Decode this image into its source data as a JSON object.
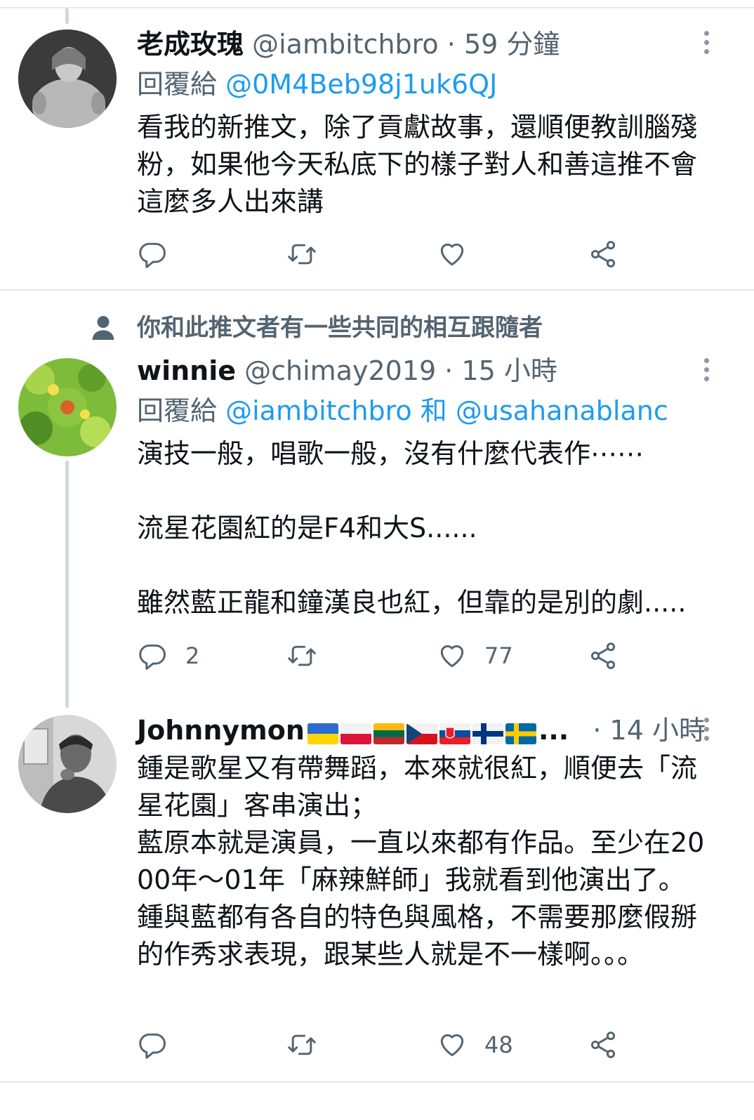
{
  "tweets": [
    {
      "name": "老成玫瑰",
      "handle": "@iambitchbro",
      "dot": "·",
      "time": "59 分鐘",
      "reply_prefix": "回覆給",
      "reply_mentions": [
        "@0M4Beb98j1uk6QJ"
      ],
      "reply_join": "",
      "body": "看我的新推文，除了貢獻故事，還順便教訓腦殘粉，如果他今天私底下的樣子對人和善這推不會這麼多人出來講",
      "reply_count": "",
      "retweet_count": "",
      "like_count": ""
    },
    {
      "social_context": "你和此推文者有一些共同的相互跟隨者",
      "name": "winnie",
      "handle": "@chimay2019",
      "dot": "·",
      "time": "15 小時",
      "reply_prefix": "回覆給",
      "reply_mentions": [
        "@iambitchbro",
        "@usahanablanc"
      ],
      "reply_join": "和",
      "body": "演技一般，唱歌一般，沒有什麼代表作⋯⋯\n\n流星花園紅的是F4和大S......\n\n雖然藍正龍和鐘漢良也紅，但靠的是別的劇.....",
      "reply_count": "2",
      "retweet_count": "",
      "like_count": "77"
    },
    {
      "name": "Johnnymon",
      "name_ellipsis": "...",
      "flags": [
        "ukraine-flag",
        "poland-flag",
        "lithuania-flag",
        "czech-flag",
        "slovakia-flag",
        "finland-flag",
        "sweden-flag"
      ],
      "dot": "·",
      "time": "14 小時",
      "body": "鍾是歌星又有帶舞蹈，本來就很紅，順便去「流星花園」客串演出；\n藍原本就是演員，一直以來都有作品。至少在2000年～01年「麻辣鮮師」我就看到他演出了。\n鍾與藍都有各自的特色與風格，不需要那麼假掰的作秀求表現，跟某些人就是不一樣啊。。。",
      "reply_count": "",
      "retweet_count": "",
      "like_count": "48"
    }
  ],
  "colors": {
    "text": "#0f1419",
    "secondary": "#536471",
    "link": "#1d9bf0",
    "divider": "#e6e9ec",
    "thread_line": "#cfd9de"
  },
  "icons": [
    "reply-icon",
    "retweet-icon",
    "like-icon",
    "share-icon",
    "more-icon",
    "person-icon"
  ]
}
